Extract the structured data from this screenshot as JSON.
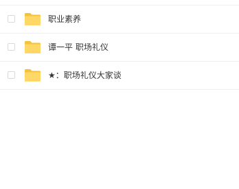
{
  "file_list": {
    "items": [
      {
        "name": "职业素养",
        "icon": "folder-icon",
        "checked": false
      },
      {
        "name": "谭一平 职场礼仪",
        "icon": "folder-icon",
        "checked": false
      },
      {
        "name": "★：职场礼仪大家谈",
        "icon": "folder-icon",
        "checked": false
      }
    ],
    "colors": {
      "folder_back": "#f5c33b",
      "folder_front": "#ffd766",
      "divider": "#eeeeee",
      "text": "#333333"
    }
  }
}
